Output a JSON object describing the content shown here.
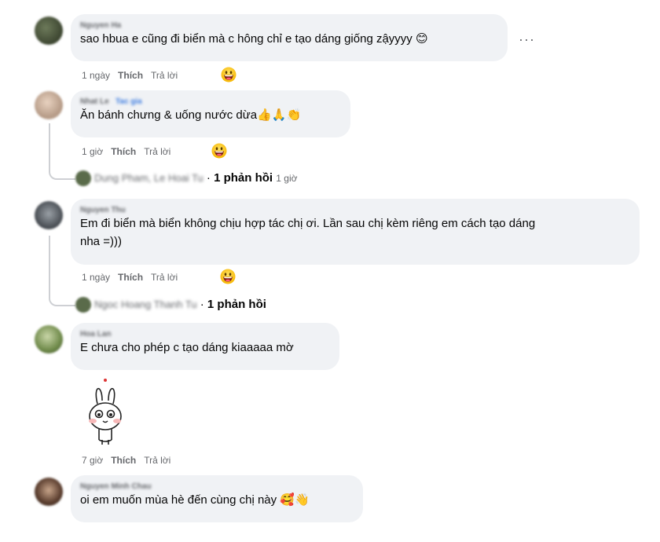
{
  "comments": [
    {
      "author": "Nguyen Ha",
      "text": "sao hbua e cũng đi biển mà c hông chỉ e tạo dáng giống zậyyyy 😊",
      "time": "1 ngày",
      "like": "Thích",
      "reply": "Trả lời"
    },
    {
      "author": "Nhat Le",
      "author_tag": "Tac gia",
      "text": "Ăn bánh chưng & uống nước dừa👍🙏👏",
      "time": "1 giờ",
      "like": "Thích",
      "reply": "Trả lời",
      "replies_names": "Dung Pham, Le Hoai Tu",
      "replies_sep": "·",
      "replies_count": "1 phản hồi",
      "replies_time": "1 giờ"
    },
    {
      "author": "Nguyen Thu",
      "text": "Em đi biển mà biển không chịu hợp tác chị ơi. Lần sau chị kèm riêng em cách tạo dáng",
      "text2": "nha =)))",
      "time": "1 ngày",
      "like": "Thích",
      "reply": "Trả lời",
      "replies_names": "Ngoc Hoang Thanh Tu",
      "replies_sep": "·",
      "replies_count": "1 phản hồi"
    },
    {
      "author": "Hoa Lan",
      "text": "E chưa cho phép c tạo dáng kiaaaaa mờ",
      "time": "7 giờ",
      "like": "Thích",
      "reply": "Trả lời",
      "sticker": "bunny-sticker"
    },
    {
      "author": "Nguyen Minh Chau",
      "text": "oi em muốn mùa hè đến cùng chị này 🥰👋"
    }
  ],
  "more_label": "···",
  "colors": {
    "bubble": "#f0f2f5",
    "meta": "#65676b",
    "text": "#050505",
    "thread_line": "#ced0d4"
  },
  "icons": [
    "grinning-face-emoji-icon",
    "more-options-icon"
  ]
}
